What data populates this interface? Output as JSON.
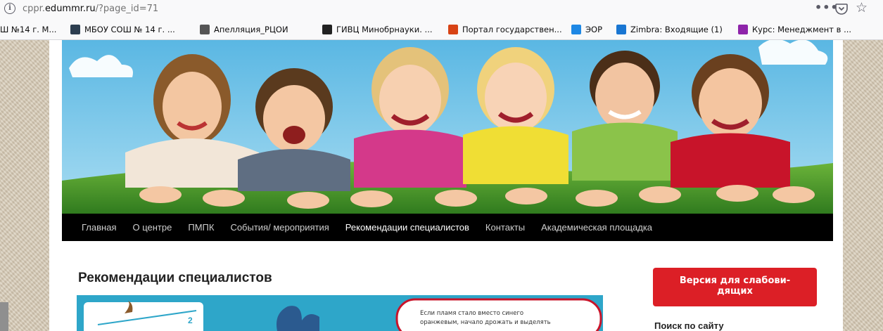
{
  "browser": {
    "url_prefix": "cppr.",
    "url_domain": "edummr.ru",
    "url_path": "/?page_id=71",
    "more_icon": "more-icon",
    "pocket_icon": "pocket-icon",
    "star_icon": "star-icon",
    "info_icon": "info-icon"
  },
  "bookmarks": [
    {
      "label": "Ш №14 г. М...",
      "icon": "school-icon",
      "color": "#3a7bd5"
    },
    {
      "label": "МБОУ СОШ № 14 г. ...",
      "icon": "school-logo-icon",
      "color": "#2c3e50"
    },
    {
      "label": "Апелляция_РЦОИ",
      "icon": "globe-icon",
      "color": "#555555"
    },
    {
      "label": "ГИВЦ Минобрнауки. ...",
      "icon": "bird-icon",
      "color": "#222222"
    },
    {
      "label": "Портал государствен...",
      "icon": "building-icon",
      "color": "#d84315"
    },
    {
      "label": "ЭОР",
      "icon": "leaf-icon",
      "color": "#1e88e5"
    },
    {
      "label": "Zimbra: Входящие (1)",
      "icon": "zimbra-icon",
      "color": "#1976d2"
    },
    {
      "label": "Курс: Менеджмент в ...",
      "icon": "course-icon",
      "color": "#8e24aa"
    }
  ],
  "nav": {
    "items": [
      {
        "label": "Главная",
        "active": false
      },
      {
        "label": "О центре",
        "active": false
      },
      {
        "label": "ПМПК",
        "active": false
      },
      {
        "label": "События/ мероприятия",
        "active": false
      },
      {
        "label": "Рекомендации специалистов",
        "active": true
      },
      {
        "label": "Контакты",
        "active": false
      },
      {
        "label": "Академическая площадка",
        "active": false
      }
    ]
  },
  "content": {
    "title": "Рекомендации специалистов",
    "image_number": "2",
    "image_text_line1": "Если пламя стало вместо синего",
    "image_text_line2": "оранжевым, начало дрожать и выделять"
  },
  "sidebar": {
    "button_line1": "Версия для слабови-",
    "button_line2": "дящих",
    "search_heading": "Поиск по сайту"
  },
  "colors": {
    "nav_bg": "#000000",
    "accent_red": "#dc1f26",
    "sky": "#6fc3e8",
    "grass": "#4f9a2b"
  }
}
